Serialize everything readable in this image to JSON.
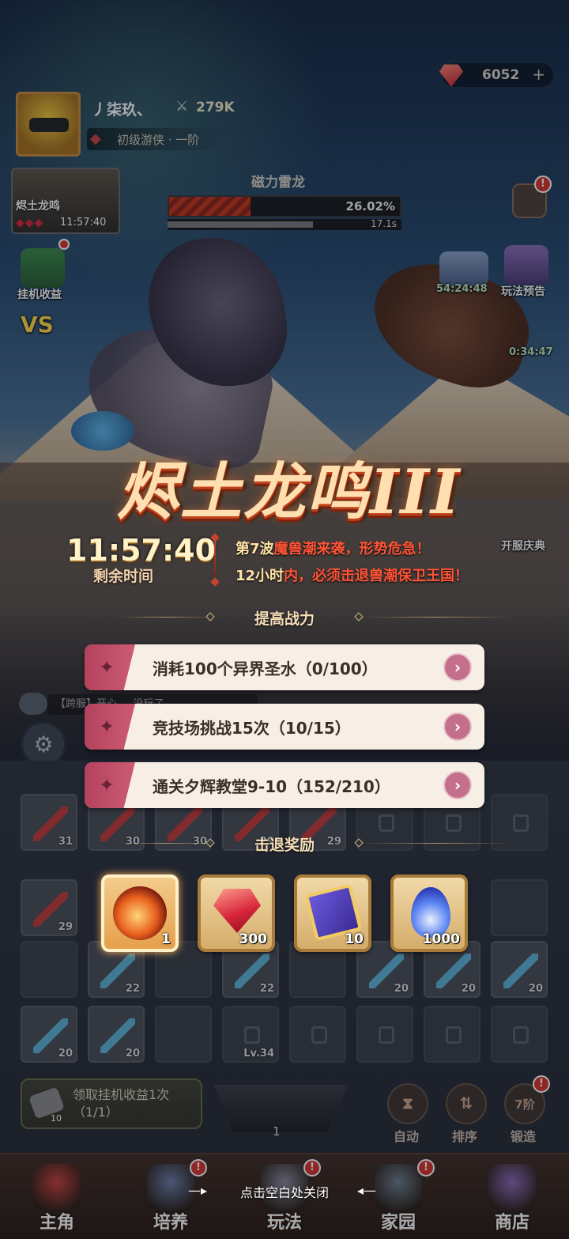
{
  "hud": {
    "gems": "6052",
    "gems_plus": "+",
    "player_name": "丿柒玖、",
    "power": "279K",
    "rank": "初级游侠 · 一阶"
  },
  "boss_card": {
    "name": "烬土龙鸣",
    "stars": "◆◆◆",
    "time": "11:57:40"
  },
  "boss_bar": {
    "title": "磁力雷龙",
    "hp_percent_text": "26.02%",
    "hp_fraction": 0.3517,
    "timer_text": "17.1s",
    "timer_fraction": 0.62
  },
  "side_icons": {
    "idle_label": "挂机收益",
    "timer_1": "54:24:48",
    "preview_label": "玩法预告",
    "timer_2": "0:34:47",
    "server_label": "开服庆典",
    "vs_label": "VS"
  },
  "event": {
    "title": "烬土龙鸣III",
    "countdown": "11:57:40",
    "countdown_label": "剩余时间",
    "line1_prefix": "第7波",
    "line1_red": "魔兽潮来袭，形势危急！",
    "line2_prefix": "12小时",
    "line2_red": "内，必须击退兽潮保卫王国！",
    "section_power": "提高战力",
    "section_reward": "击退奖励",
    "close_hint": "点击空白处关闭"
  },
  "tasks": [
    {
      "label": "消耗100个异界圣水（0/100）",
      "go": "›"
    },
    {
      "label": "竞技场挑战15次（10/15）",
      "go": "›"
    },
    {
      "label": "通关夕辉教堂9-10（152/210）",
      "go": "›"
    }
  ],
  "rewards": [
    {
      "icon": "fire-blade-icon",
      "count": "1"
    },
    {
      "icon": "ruby-icon",
      "count": "300"
    },
    {
      "icon": "spellbook-icon",
      "count": "10"
    },
    {
      "icon": "blue-flame-icon",
      "count": "1000"
    }
  ],
  "inventory": {
    "row1": [
      "31",
      "30",
      "30",
      "29",
      "29"
    ],
    "row2_left": "29",
    "row3": [
      "22",
      "22",
      "20",
      "20",
      "20"
    ],
    "row4": [
      "20",
      "20"
    ],
    "lock_level": "Lv.34"
  },
  "bottom": {
    "idle_claim": "领取挂机收益1次（1/1）",
    "idle_count": "10",
    "forge_count": "1",
    "auto_label": "自动",
    "sort_label": "排序",
    "forge_label": "锻造",
    "forge_badge": "7阶"
  },
  "nav": [
    {
      "label": "主角",
      "icon": "hero-crown-icon"
    },
    {
      "label": "培养",
      "icon": "knight-helmet-icon"
    },
    {
      "label": "玩法",
      "icon": "crossed-swords-icon"
    },
    {
      "label": "家园",
      "icon": "home-icon"
    },
    {
      "label": "商店",
      "icon": "shop-icon"
    }
  ],
  "badges": {
    "alert": "!"
  },
  "chat": {
    "text": "【跨服】开心 ... 没玩了"
  }
}
